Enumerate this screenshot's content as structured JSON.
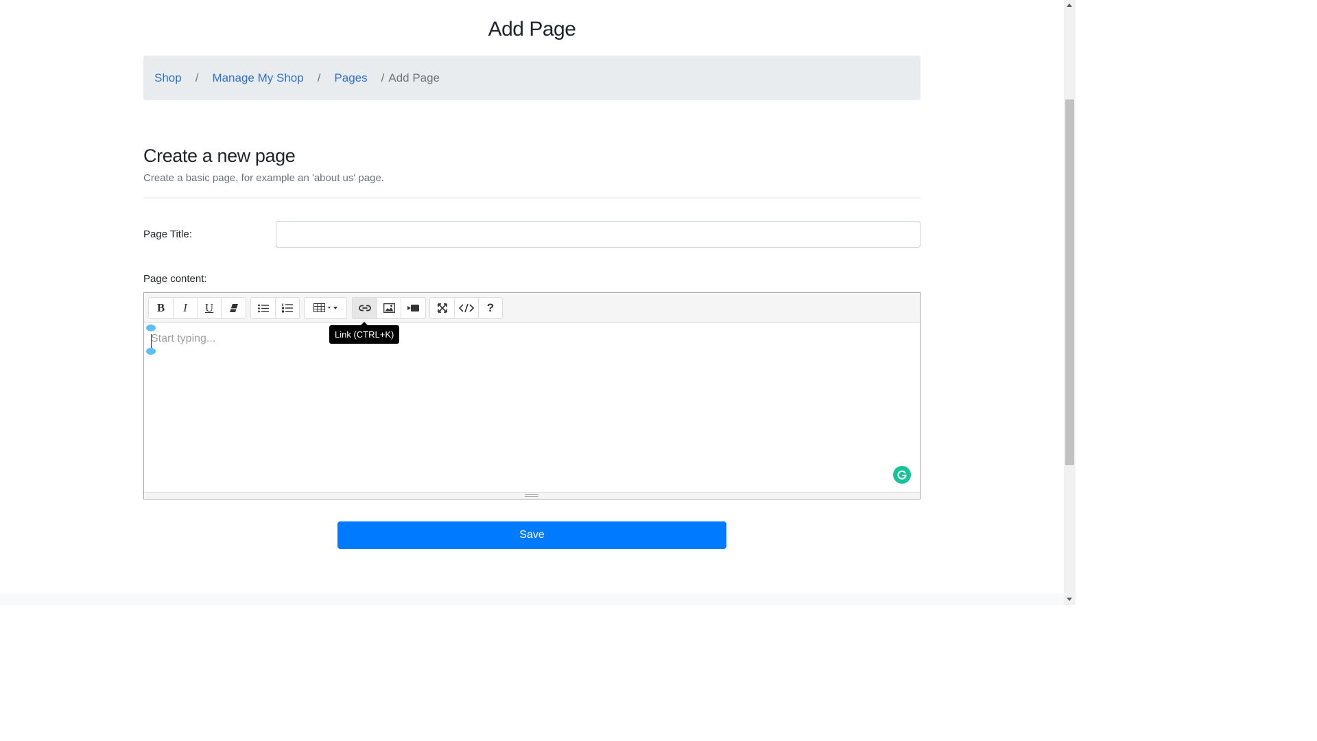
{
  "page": {
    "heading": "Add Page"
  },
  "breadcrumb": {
    "items": [
      {
        "label": "Shop"
      },
      {
        "label": "Manage My Shop"
      },
      {
        "label": "Pages"
      }
    ],
    "separator": "/",
    "current": "Add Page"
  },
  "section": {
    "title": "Create a new page",
    "subtitle": "Create a basic page, for example an 'about us' page."
  },
  "form": {
    "title_label": "Page Title:",
    "title_value": "",
    "content_label": "Page content:",
    "content_placeholder": "Start typing...",
    "save_label": "Save"
  },
  "editor": {
    "toolbar": {
      "bold_label": "B",
      "italic_label": "I",
      "underline_label": "U",
      "help_label": "?",
      "icons": [
        "bold-icon",
        "italic-icon",
        "underline-icon",
        "eraser-icon",
        "unordered-list-icon",
        "ordered-list-icon",
        "table-icon",
        "link-icon",
        "picture-icon",
        "video-icon",
        "fullscreen-icon",
        "code-view-icon",
        "help-icon"
      ]
    },
    "tooltip": "Link (CTRL+K)"
  },
  "colors": {
    "primary": "#007bff",
    "link": "#2f72d0",
    "breadcrumb_bg": "#e9ecef",
    "grammarly": "#15c39a",
    "tooltip_bg": "#000000"
  }
}
